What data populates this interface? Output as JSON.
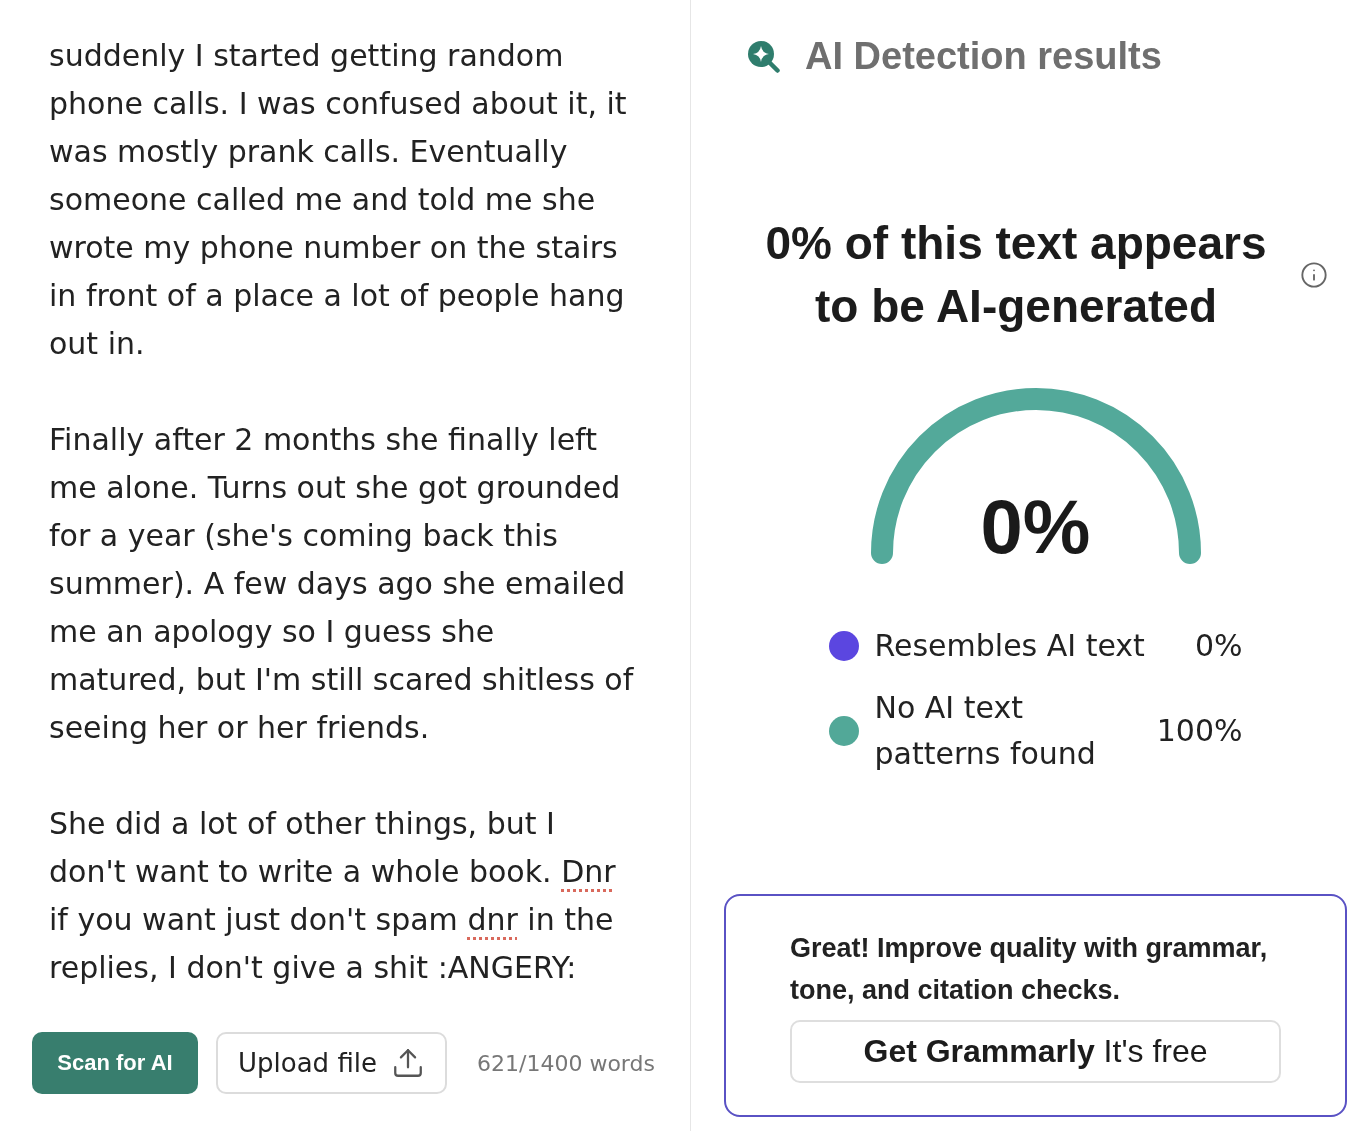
{
  "editor": {
    "paragraphs": [
      {
        "segments": [
          {
            "text": "suddenly I started getting random phone calls. I was confused about it, it was mostly prank calls. Eventually someone called me and told me she wrote my phone number on the stairs in front of a place a lot of people hang out in.",
            "misspelled": false
          }
        ]
      },
      {
        "segments": [
          {
            "text": "Finally after 2 months she finally left me alone. Turns out she got grounded for a year (she's coming back this summer). A few days ago she emailed me an apology so I guess she matured, but I'm still scared shitless of seeing her or her friends.",
            "misspelled": false
          }
        ]
      },
      {
        "segments": [
          {
            "text": "She did a lot of other things, but I don't want to write a whole book. ",
            "misspelled": false
          },
          {
            "text": "Dnr",
            "misspelled": true
          },
          {
            "text": " if you want just don't spam ",
            "misspelled": false
          },
          {
            "text": "dnr",
            "misspelled": true
          },
          {
            "text": " in the replies, I don't give a shit :ANGERY:",
            "misspelled": false
          }
        ]
      }
    ]
  },
  "toolbar": {
    "buttons": [
      {
        "label": "Scan for AI",
        "kind": "primary"
      },
      {
        "label": "Upload file",
        "kind": "upload"
      }
    ],
    "word_count": "621/1400 words"
  },
  "results": {
    "title": "AI Detection results",
    "headline": "0% of this text appears to be AI-generated",
    "score": "0%",
    "legend": [
      {
        "label": "Resembles AI text",
        "value": "0%",
        "color": "#5b46e0"
      },
      {
        "label": "No AI text patterns found",
        "value": "100%",
        "color": "#52a898"
      }
    ]
  },
  "promo": {
    "text": "Great! Improve quality with grammar, tone, and citation checks.",
    "button": "**Get Grammarly** It's free"
  }
}
